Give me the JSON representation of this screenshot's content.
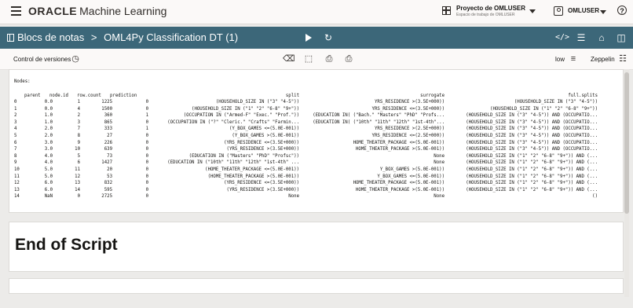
{
  "header": {
    "brand_oracle": "ORACLE",
    "brand_product": "Machine Learning",
    "project_title": "Proyecto de OMLUSER",
    "project_subtitle": "Espacio de trabajo de OMLUSER",
    "user_name": "OMLUSER",
    "help_label": "?"
  },
  "notebook": {
    "breadcrumb_root": "Blocs de notas",
    "separator": ">",
    "notebook_title": "OML4Py Classification DT (1)"
  },
  "toolbar": {
    "version_control": "Control de versiones",
    "priority": "low",
    "interpreter": "Zeppelin"
  },
  "output": {
    "nodes_label": "Nodes:",
    "columns": [
      "parent",
      "node.id",
      "row.count",
      "prediction",
      "split",
      "surrogate",
      "full.splits"
    ],
    "rows": [
      [
        "0",
        "0.0",
        "1",
        "1225",
        "0",
        "(HOUSEHOLD_SIZE IN (\"3\" \"4-5\"))",
        "YRS_RESIDENCE >(3.5E+000))",
        "(HOUSEHOLD_SIZE IN (\"3\" \"4-5\"))"
      ],
      [
        "1",
        "0.0",
        "4",
        "1500",
        "0",
        "(HOUSEHOLD_SIZE IN (\"1\" \"2\" \"6-8\" \"9+\"))",
        "YRS_RESIDENCE <=(3.5E+000))",
        "(HOUSEHOLD_SIZE IN (\"1\" \"2\" \"6-8\" \"9+\"))"
      ],
      [
        "2",
        "1.0",
        "2",
        "360",
        "1",
        "(OCCUPATION IN (\"Armed-F\" \"Exec.\" \"Prof.\"))",
        "(EDUCATION IN( (\"Bach.\" \"Masters\" \"PhD\" \"Profs...",
        "(HOUSEHOLD_SIZE IN (\"3\" \"4-5\")) AND (OCCUPATIO..."
      ],
      [
        "3",
        "1.0",
        "3",
        "865",
        "0",
        "(OCCUPATION IN (\"?\" \"Cleric.\" \"Crafts\" \"Farmin...",
        "(EDUCATION IN( (\"10th\" \"11th\" \"12th\" \"1st-4th\"...",
        "(HOUSEHOLD_SIZE IN (\"3\" \"4-5\")) AND (OCCUPATIO..."
      ],
      [
        "4",
        "2.0",
        "7",
        "333",
        "1",
        "(Y_BOX_GAMES <=(5.0E-001))",
        "YRS_RESIDENCE >(2.5E+000))",
        "(HOUSEHOLD_SIZE IN (\"3\" \"4-5\")) AND (OCCUPATIO..."
      ],
      [
        "5",
        "2.0",
        "8",
        "27",
        "0",
        "(Y_BOX_GAMES >(5.0E-001))",
        "YRS_RESIDENCE <=(2.5E+000))",
        "(HOUSEHOLD_SIZE IN (\"3\" \"4-5\")) AND (OCCUPATIO..."
      ],
      [
        "6",
        "3.0",
        "9",
        "226",
        "0",
        "(YRS_RESIDENCE <=(3.5E+000))",
        "HOME_THEATER_PACKAGE <=(5.0E-001))",
        "(HOUSEHOLD_SIZE IN (\"3\" \"4-5\")) AND (OCCUPATIO..."
      ],
      [
        "7",
        "3.0",
        "10",
        "639",
        "0",
        "(YRS_RESIDENCE >(3.5E+000))",
        "HOME_THEATER_PACKAGE >(5.0E-001))",
        "(HOUSEHOLD_SIZE IN (\"3\" \"4-5\")) AND (OCCUPATIO..."
      ],
      [
        "8",
        "4.0",
        "5",
        "73",
        "0",
        "(EDUCATION IN (\"Masters\" \"PhD\" \"Profsc\"))",
        "None",
        "(HOUSEHOLD_SIZE IN (\"1\" \"2\" \"6-8\" \"9+\")) AND (..."
      ],
      [
        "9",
        "4.0",
        "6",
        "1427",
        "0",
        "(EDUCATION IN (\"10th\" \"11th\" \"12th\" \"1st-4th\" ...",
        "None",
        "(HOUSEHOLD_SIZE IN (\"1\" \"2\" \"6-8\" \"9+\")) AND (..."
      ],
      [
        "10",
        "5.0",
        "11",
        "20",
        "0",
        "(HOME_THEATER_PACKAGE <=(5.0E-001))",
        "Y_BOX_GAMES >(5.0E-001))",
        "(HOUSEHOLD_SIZE IN (\"1\" \"2\" \"6-8\" \"9+\")) AND (..."
      ],
      [
        "11",
        "5.0",
        "12",
        "53",
        "0",
        "(HOME_THEATER_PACKAGE >(5.0E-001))",
        "Y_BOX_GAMES <=(5.0E-001))",
        "(HOUSEHOLD_SIZE IN (\"1\" \"2\" \"6-8\" \"9+\")) AND (..."
      ],
      [
        "12",
        "6.0",
        "13",
        "832",
        "0",
        "(YRS_RESIDENCE <=(3.5E+000))",
        "HOME_THEATER_PACKAGE <=(5.0E-001))",
        "(HOUSEHOLD_SIZE IN (\"1\" \"2\" \"6-8\" \"9+\")) AND (..."
      ],
      [
        "13",
        "6.0",
        "14",
        "595",
        "0",
        "(YRS_RESIDENCE >(3.5E+000))",
        "HOME_THEATER_PACKAGE >(5.0E-001))",
        "(HOUSEHOLD_SIZE IN (\"1\" \"2\" \"6-8\" \"9+\")) AND (..."
      ],
      [
        "14",
        "NaN",
        "0",
        "2725",
        "0",
        "None",
        "None",
        "()"
      ]
    ]
  },
  "end_section": {
    "title": "End of Script"
  }
}
